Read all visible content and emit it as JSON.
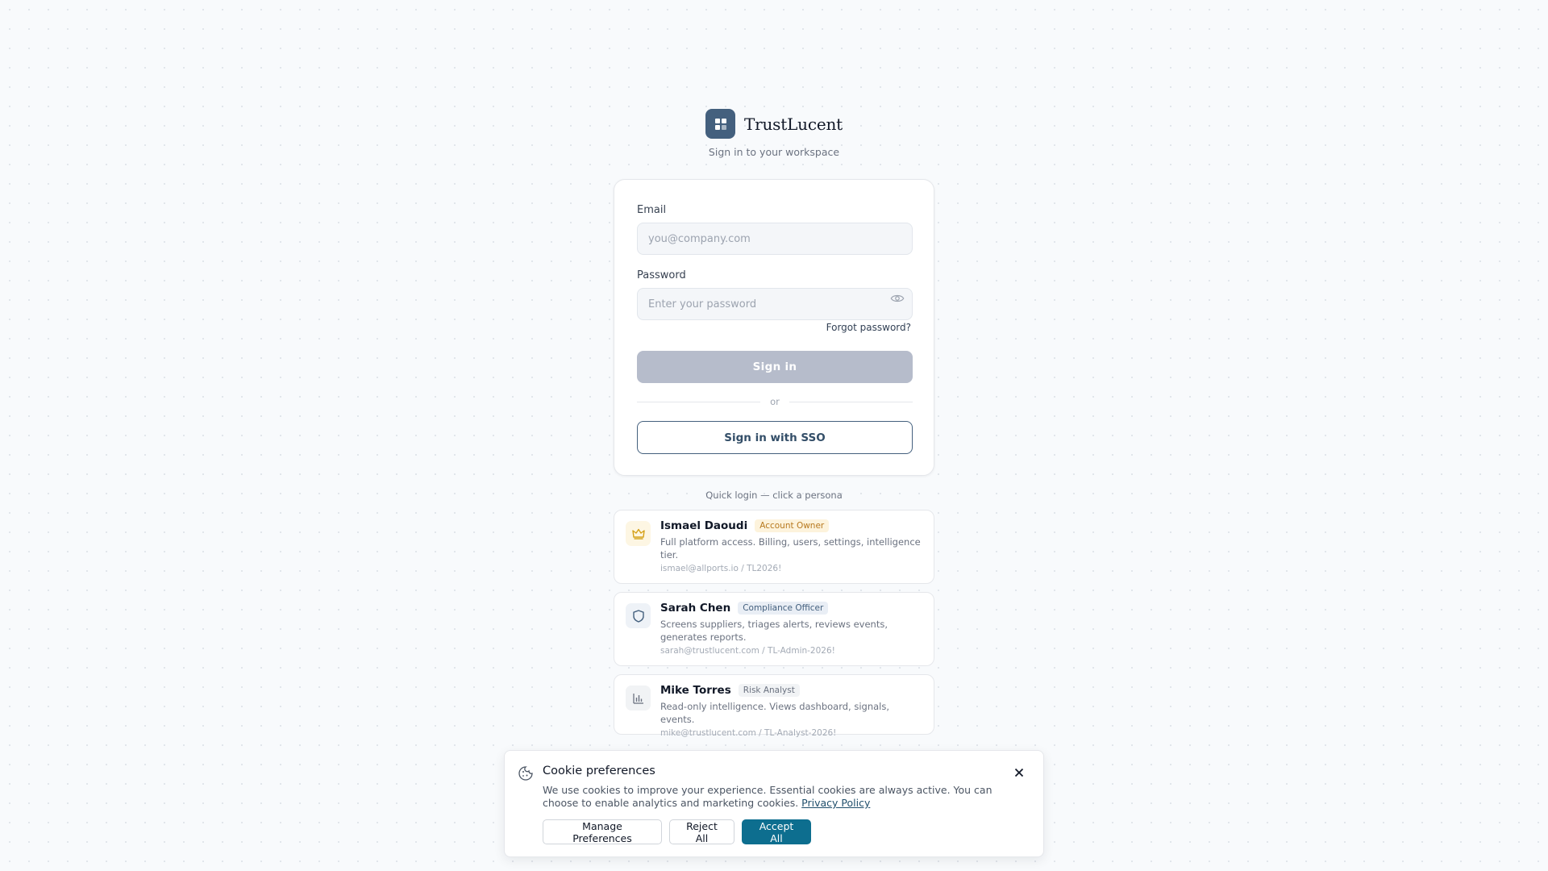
{
  "app": {
    "name": "TrustLucent",
    "subtitle": "Sign in to your workspace"
  },
  "login_form": {
    "email_label": "Email",
    "email_placeholder": "you@company.com",
    "email_value": "",
    "password_label": "Password",
    "password_placeholder": "Enter your password",
    "password_value": "",
    "password_toggle_icon": "eye-icon",
    "forgot_label": "Forgot password?",
    "signin_label": "Sign in",
    "divider_label": "or",
    "sso_label": "Sign in with SSO"
  },
  "quick_login": {
    "label": "Quick login — click a persona",
    "personas": [
      {
        "name": "Ismael Daoudi",
        "role": "Account Owner",
        "description": "Full platform access. Billing, users, settings, intelligence tier.",
        "credentials": "ismael@allports.io / TL2026!",
        "icon": "crown-icon",
        "icon_color": "#d4a017",
        "icon_bg": "#fdf6e3",
        "badge_bg": "#fdf3dc",
        "badge_color": "#b7791f"
      },
      {
        "name": "Sarah Chen",
        "role": "Compliance Officer",
        "description": "Screens suppliers, triages alerts, reviews events, generates reports.",
        "credentials": "sarah@trustlucent.com / TL-Admin-2026!",
        "icon": "shield-icon",
        "icon_color": "#44607e",
        "icon_bg": "#eef2f7",
        "badge_bg": "#e9eef5",
        "badge_color": "#44607e"
      },
      {
        "name": "Mike Torres",
        "role": "Risk Analyst",
        "description": "Read-only intelligence. Views dashboard, signals, events.",
        "credentials": "mike@trustlucent.com / TL-Analyst-2026!",
        "icon": "bar-chart-icon",
        "icon_color": "#6b7280",
        "icon_bg": "#f1f3f5",
        "badge_bg": "#f1f3f5",
        "badge_color": "#6b7280"
      }
    ]
  },
  "cookie_banner": {
    "title": "Cookie preferences",
    "text": "We use cookies to improve your experience. Essential cookies are always active. You can choose to enable analytics and marketing cookies.",
    "link_label": "Privacy Policy",
    "manage_label": "Manage Preferences",
    "reject_label": "Reject All",
    "accept_label": "Accept All",
    "accent_color": "#0d6e8f"
  }
}
